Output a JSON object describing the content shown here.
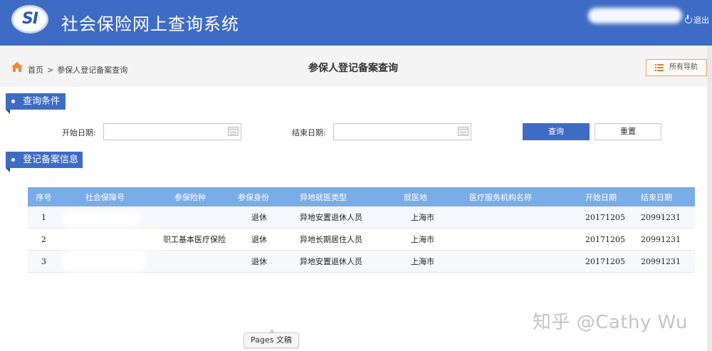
{
  "header": {
    "logo_text": "SI",
    "app_title": "社会保险网上查询系统",
    "logout_label": "退出"
  },
  "breadcrumb": {
    "home": "首页",
    "separator": ">",
    "current": "参保人登记备案查询"
  },
  "page_title": "参保人登记备案查询",
  "nav_button": {
    "label": "所有导航",
    "icon": "list-icon"
  },
  "query_section": {
    "label": "查询条件",
    "start_date_label": "开始日期:",
    "start_date_value": "",
    "end_date_label": "结束日期:",
    "end_date_value": "",
    "query_button": "查询",
    "reset_button": "重置"
  },
  "records_section": {
    "label": "登记备案信息",
    "columns": [
      "序号",
      "社会保障号",
      "参保险种",
      "参保身份",
      "异地就医类型",
      "就医地",
      "医疗服务机构名称",
      "开始日期",
      "结束日期"
    ],
    "rows": [
      {
        "seq": "1",
        "ssn": "",
        "insurance": "",
        "identity": "退休",
        "type": "异地安置退休人员",
        "location": "上海市",
        "institution": "",
        "start": "20171205",
        "end": "20991231"
      },
      {
        "seq": "2",
        "ssn": "",
        "insurance": "职工基本医疗保险",
        "identity": "退休",
        "type": "异地长期居住人员",
        "location": "上海市",
        "institution": "",
        "start": "20171205",
        "end": "20991231"
      },
      {
        "seq": "3",
        "ssn": "",
        "insurance": "",
        "identity": "退休",
        "type": "异地安置退休人员",
        "location": "上海市",
        "institution": "",
        "start": "20171205",
        "end": "20991231"
      }
    ]
  },
  "watermark": "知乎 @Cathy Wu",
  "tooltip": "Pages 文稿",
  "colors": {
    "primary": "#3e6cc5",
    "table_header": "#7aade8",
    "nav_border": "#f0a060",
    "home_icon": "#f08a3c"
  }
}
